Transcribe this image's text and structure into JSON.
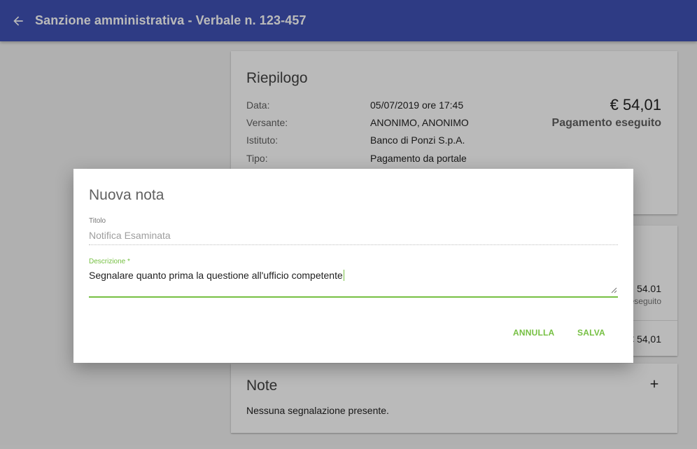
{
  "appbar": {
    "title": "Sanzione amministrativa - Verbale n. 123-457",
    "back_icon": "arrow-back-icon",
    "bg_color": "#3f51b5"
  },
  "summary": {
    "title": "Riepilogo",
    "rows": [
      {
        "label": "Data:",
        "value": "05/07/2019 ore 17:45"
      },
      {
        "label": "Versante:",
        "value": "ANONIMO, ANONIMO"
      },
      {
        "label": "Istituto:",
        "value": "Banco di Ponzi S.p.A."
      },
      {
        "label": "Tipo:",
        "value": "Pagamento da portale"
      }
    ],
    "amount": "€ 54,01",
    "status": "Pagamento eseguito"
  },
  "mid_card": {
    "row1_value": "54.01",
    "row1_sub": "eseguito",
    "row2_value": "€ 54,01"
  },
  "notes": {
    "title": "Note",
    "add_icon": "plus-icon",
    "empty_text": "Nessuna segnalazione presente."
  },
  "dialog": {
    "title": "Nuova nota",
    "title_field": {
      "label": "Titolo",
      "value": "Notifica Esaminata"
    },
    "desc_field": {
      "label": "Descrizione *",
      "value": "Segnalare quanto prima la questione all'ufficio competente"
    },
    "cancel_label": "ANNULLA",
    "save_label": "SALVA",
    "accent_color": "#76c043"
  }
}
